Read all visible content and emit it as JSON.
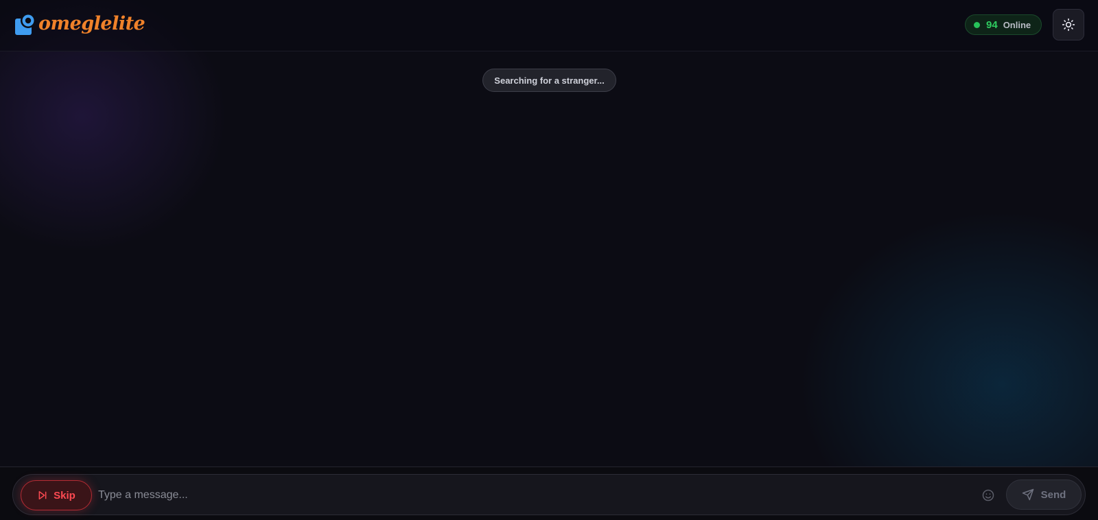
{
  "header": {
    "logo_text": "omeglelite",
    "online": {
      "count": "94",
      "label": "Online"
    }
  },
  "status": {
    "text": "Searching for a stranger..."
  },
  "composer": {
    "skip_label": "Skip",
    "message_placeholder": "Type a message...",
    "send_label": "Send"
  },
  "icons": {
    "logo": "omegle-logo-icon",
    "online_indicator": "green-dot-icon",
    "theme": "sun-icon",
    "skip": "skip-forward-icon",
    "emoji": "smiley-icon",
    "send": "paper-plane-icon"
  },
  "colors": {
    "brand": "#f0822a",
    "logo_blue": "#3f9cf0",
    "online_green": "#2fcc60",
    "skip_red": "#ff4a52",
    "background": "#0c0c14"
  }
}
